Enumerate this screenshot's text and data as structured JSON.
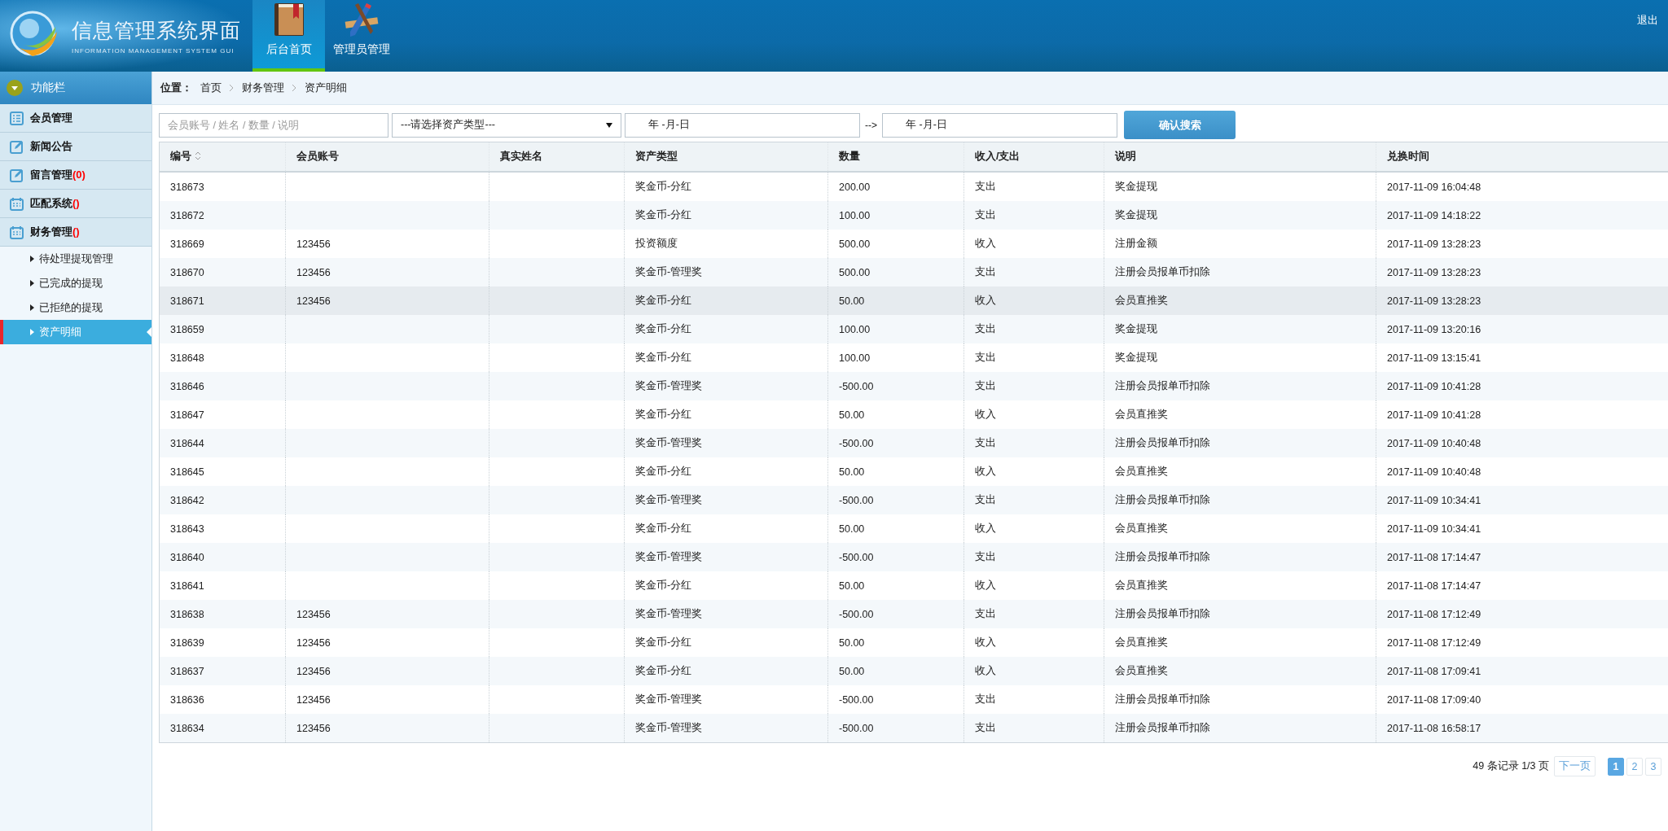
{
  "header": {
    "title": "信息管理系统界面",
    "subtitle": "INFORMATION MANAGEMENT SYSTEM GUI",
    "logout": "退出",
    "tabs": [
      {
        "label": "后台首页",
        "kind": "book",
        "selected": true
      },
      {
        "label": "管理员管理",
        "kind": "tools",
        "selected": false
      }
    ]
  },
  "sidebar": {
    "title": "功能栏",
    "items": [
      {
        "label": "会员管理",
        "kind": "list"
      },
      {
        "label": "新闻公告",
        "kind": "edit"
      },
      {
        "label": "留言管理",
        "badge": "(0)",
        "kind": "edit"
      },
      {
        "label": "匹配系统",
        "badge": "()",
        "kind": "calendar"
      },
      {
        "label": "财务管理",
        "badge": "()",
        "kind": "calendar",
        "children": [
          {
            "label": "待处理提现管理",
            "selected": false
          },
          {
            "label": "已完成的提现",
            "selected": false
          },
          {
            "label": "已拒绝的提现",
            "selected": false
          },
          {
            "label": "资产明细",
            "selected": true
          }
        ]
      }
    ]
  },
  "breadcrumb": {
    "label": "位置：",
    "items": [
      "首页",
      "财务管理",
      "资产明细"
    ]
  },
  "search": {
    "placeholder": "会员账号 / 姓名 / 数量 / 说明",
    "type_select": "---请选择资产类型---",
    "date_from": "年 -月-日",
    "separator": "-->",
    "date_to": "年 -月-日",
    "button": "确认搜索"
  },
  "table": {
    "columns": [
      "编号",
      "会员账号",
      "真实姓名",
      "资产类型",
      "数量",
      "收入/支出",
      "说明",
      "兑换时间"
    ],
    "rows": [
      {
        "selected": false,
        "cells": [
          "318673",
          "",
          "",
          "奖金币-分红",
          "200.00",
          "支出",
          "奖金提现",
          "2017-11-09 16:04:48"
        ]
      },
      {
        "selected": false,
        "cells": [
          "318672",
          "",
          "",
          "奖金币-分红",
          "100.00",
          "支出",
          "奖金提现",
          "2017-11-09 14:18:22"
        ]
      },
      {
        "selected": false,
        "cells": [
          "318669",
          "123456",
          "",
          "投资额度",
          "500.00",
          "收入",
          "注册金额",
          "2017-11-09 13:28:23"
        ]
      },
      {
        "selected": false,
        "cells": [
          "318670",
          "123456",
          "",
          "奖金币-管理奖",
          "500.00",
          "支出",
          "注册会员报单币扣除",
          "2017-11-09 13:28:23"
        ]
      },
      {
        "selected": true,
        "cells": [
          "318671",
          "123456",
          "",
          "奖金币-分红",
          "50.00",
          "收入",
          "会员直推奖",
          "2017-11-09 13:28:23"
        ]
      },
      {
        "selected": false,
        "cells": [
          "318659",
          "",
          "",
          "奖金币-分红",
          "100.00",
          "支出",
          "奖金提现",
          "2017-11-09 13:20:16"
        ]
      },
      {
        "selected": false,
        "cells": [
          "318648",
          "",
          "",
          "奖金币-分红",
          "100.00",
          "支出",
          "奖金提现",
          "2017-11-09 13:15:41"
        ]
      },
      {
        "selected": false,
        "cells": [
          "318646",
          "",
          "",
          "奖金币-管理奖",
          "-500.00",
          "支出",
          "注册会员报单币扣除",
          "2017-11-09 10:41:28"
        ]
      },
      {
        "selected": false,
        "cells": [
          "318647",
          "",
          "",
          "奖金币-分红",
          "50.00",
          "收入",
          "会员直推奖",
          "2017-11-09 10:41:28"
        ]
      },
      {
        "selected": false,
        "cells": [
          "318644",
          "",
          "",
          "奖金币-管理奖",
          "-500.00",
          "支出",
          "注册会员报单币扣除",
          "2017-11-09 10:40:48"
        ]
      },
      {
        "selected": false,
        "cells": [
          "318645",
          "",
          "",
          "奖金币-分红",
          "50.00",
          "收入",
          "会员直推奖",
          "2017-11-09 10:40:48"
        ]
      },
      {
        "selected": false,
        "cells": [
          "318642",
          "",
          "",
          "奖金币-管理奖",
          "-500.00",
          "支出",
          "注册会员报单币扣除",
          "2017-11-09 10:34:41"
        ]
      },
      {
        "selected": false,
        "cells": [
          "318643",
          "",
          "",
          "奖金币-分红",
          "50.00",
          "收入",
          "会员直推奖",
          "2017-11-09 10:34:41"
        ]
      },
      {
        "selected": false,
        "cells": [
          "318640",
          "",
          "",
          "奖金币-管理奖",
          "-500.00",
          "支出",
          "注册会员报单币扣除",
          "2017-11-08 17:14:47"
        ]
      },
      {
        "selected": false,
        "cells": [
          "318641",
          "",
          "",
          "奖金币-分红",
          "50.00",
          "收入",
          "会员直推奖",
          "2017-11-08 17:14:47"
        ]
      },
      {
        "selected": false,
        "cells": [
          "318638",
          "123456",
          "",
          "奖金币-管理奖",
          "-500.00",
          "支出",
          "注册会员报单币扣除",
          "2017-11-08 17:12:49"
        ]
      },
      {
        "selected": false,
        "cells": [
          "318639",
          "123456",
          "",
          "奖金币-分红",
          "50.00",
          "收入",
          "会员直推奖",
          "2017-11-08 17:12:49"
        ]
      },
      {
        "selected": false,
        "cells": [
          "318637",
          "123456",
          "",
          "奖金币-分红",
          "50.00",
          "收入",
          "会员直推奖",
          "2017-11-08 17:09:41"
        ]
      },
      {
        "selected": false,
        "cells": [
          "318636",
          "123456",
          "",
          "奖金币-管理奖",
          "-500.00",
          "支出",
          "注册会员报单币扣除",
          "2017-11-08 17:09:40"
        ]
      },
      {
        "selected": false,
        "cells": [
          "318634",
          "123456",
          "",
          "奖金币-管理奖",
          "-500.00",
          "支出",
          "注册会员报单币扣除",
          "2017-11-08 16:58:17"
        ]
      }
    ]
  },
  "pagination": {
    "summary": "49 条记录 1/3 页",
    "next": "下一页",
    "pages": [
      {
        "label": "1",
        "selected": true
      },
      {
        "label": "2",
        "selected": false
      },
      {
        "label": "3",
        "selected": false
      }
    ]
  }
}
